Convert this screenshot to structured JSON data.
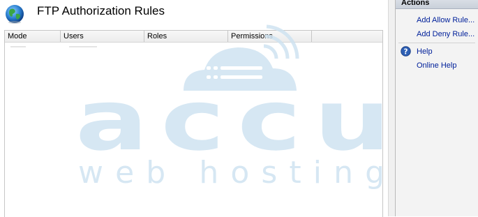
{
  "page": {
    "title": "FTP Authorization Rules"
  },
  "list": {
    "columns": [
      "Mode",
      "Users",
      "Roles",
      "Permissions"
    ]
  },
  "actions": {
    "header": "Actions",
    "items": [
      {
        "label": "Add Allow Rule...",
        "icon": ""
      },
      {
        "label": "Add Deny Rule...",
        "icon": ""
      },
      {
        "label": "Help",
        "icon": "help-icon"
      },
      {
        "label": "Online Help",
        "icon": ""
      }
    ]
  },
  "watermark": {
    "brand": "accu",
    "tagline": "web hosting"
  },
  "colors": {
    "action_link": "#00209a",
    "watermark": "#cfe3f1",
    "actions_header": "#cdd4de"
  }
}
